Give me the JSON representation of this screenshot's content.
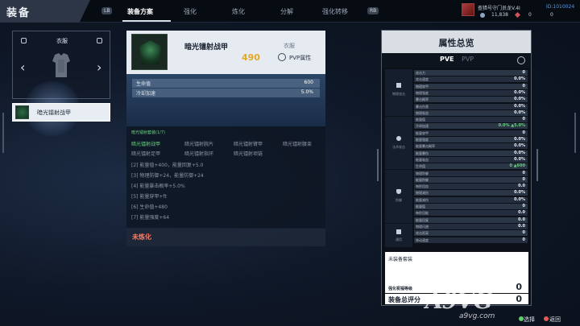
{
  "header": {
    "title": "装备",
    "lb_key": "LB",
    "rb_key": "RB",
    "tabs": [
      "装备方案",
      "强化",
      "炼化",
      "分解",
      "强化转移"
    ]
  },
  "player": {
    "name": "查猎号守门员龙V.4I",
    "uid": "ID:1010024",
    "coins": "11,838",
    "gems": "0",
    "currency3": "0"
  },
  "slot": {
    "label": "衣服",
    "prev_arrow": "‹",
    "next_arrow": "›",
    "selected_item": "暗光镭射战甲"
  },
  "item": {
    "name": "暗光镭射战甲",
    "slot_type": "衣服",
    "score": "490",
    "pvp_label": "PVP属性",
    "stats": [
      {
        "key": "生命值",
        "value": "600"
      },
      {
        "key": "冷却加速",
        "value": "5.0%"
      }
    ],
    "set": {
      "title": "暗光镭射套装(1/7)",
      "pieces": [
        "暗光镭射战甲",
        "暗光镭射腕片",
        "暗光镭射臂甲",
        "暗光镭射腰束",
        "暗光镭射足甲",
        "暗光镭射指环",
        "暗光镭射项链"
      ],
      "bonuses": [
        "[2] 能量值+400，能量回复+5.0",
        "[3] 物理防御+24，能量防御+24",
        "[4] 能量暴击概率+5.0%",
        "[5] 能量穿甲+ft",
        "[6] 生命值+480",
        "[7] 能量强度+64"
      ]
    },
    "refine_status": "未炼化"
  },
  "attributes": {
    "title": "属性总览",
    "mode_pve": "PVE",
    "mode_pvp": "PVP",
    "categories": [
      "物理攻击",
      "法术攻击",
      "防御",
      "通用"
    ],
    "rows": [
      {
        "key": "攻击力",
        "value": "0"
      },
      {
        "key": "攻击速度",
        "value": "0.0%"
      },
      {
        "key": "物理穿甲",
        "value": "0"
      },
      {
        "key": "物理强度",
        "value": "0.0%"
      },
      {
        "key": "暴击概率",
        "value": "0.0%"
      },
      {
        "key": "暴击伤害",
        "value": "0.0%"
      },
      {
        "key": "物理吸血",
        "value": "0.0%"
      },
      {
        "key": "能量值",
        "value": "0"
      },
      {
        "key": "冷却加速",
        "value": "0.0% ▲5.0%",
        "green": true
      },
      {
        "key": "能量穿甲",
        "value": "0"
      },
      {
        "key": "能量强度",
        "value": "0.0%"
      },
      {
        "key": "能量暴击概率",
        "value": "0.0%"
      },
      {
        "key": "能量暴伤",
        "value": "0.0%"
      },
      {
        "key": "能量吸血",
        "value": "0.0%"
      },
      {
        "key": "生命值",
        "value": "0 ▲600",
        "green": true
      },
      {
        "key": "物理防御",
        "value": "0"
      },
      {
        "key": "能量防御",
        "value": "0"
      },
      {
        "key": "每秒回血",
        "value": "0.0"
      },
      {
        "key": "物理减伤",
        "value": "0.0%"
      },
      {
        "key": "能量减伤",
        "value": "0.0%"
      },
      {
        "key": "能量值",
        "value": "0"
      },
      {
        "key": "每秒回能",
        "value": "0.0"
      },
      {
        "key": "能量回复",
        "value": "0.0"
      },
      {
        "key": "物理闪避",
        "value": "0.0"
      },
      {
        "key": "攻击距离",
        "value": "0"
      },
      {
        "key": "移动速度",
        "value": "0"
      }
    ],
    "suit_label": "未装备套装",
    "strength_label": "强化祝福等级",
    "strength_value": "0",
    "score_label": "装备总评分",
    "score_value": "0"
  },
  "hints": {
    "select": "选择",
    "back": "返回"
  },
  "watermark": {
    "logo": "A9VG",
    "sub": "a9vg.com"
  }
}
